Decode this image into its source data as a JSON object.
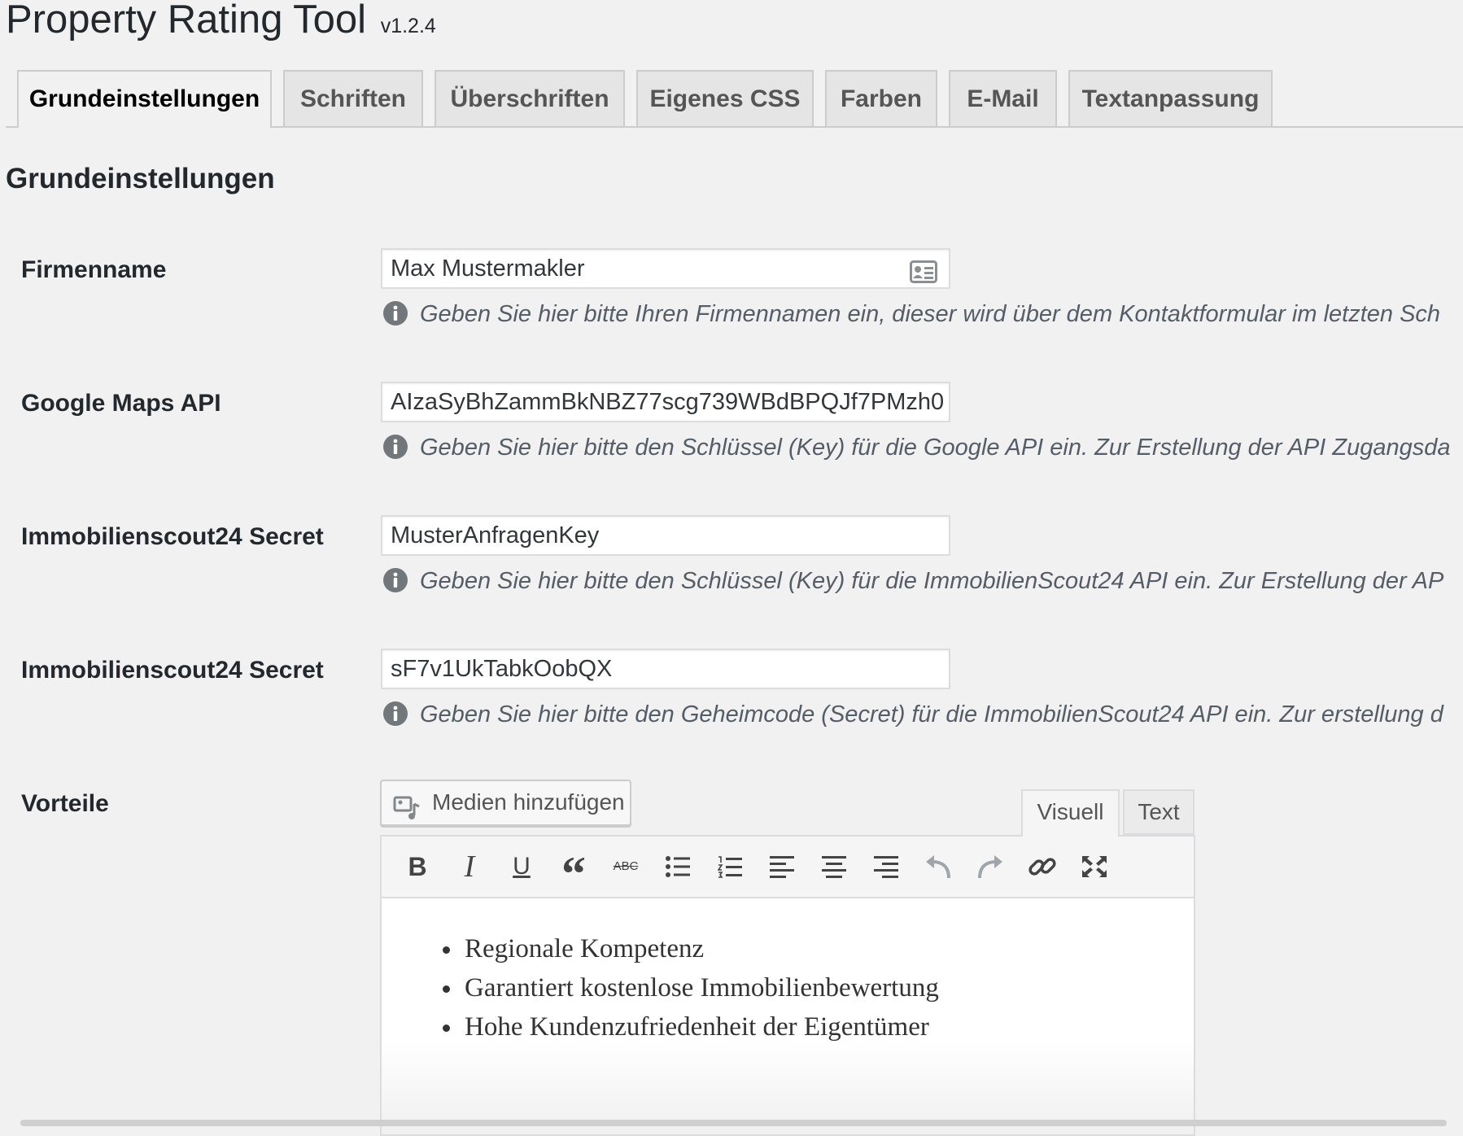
{
  "app": {
    "title": "Property Rating Tool",
    "version": "v1.2.4"
  },
  "tabs": [
    {
      "label": "Grundeinstellungen",
      "active": true
    },
    {
      "label": "Schriften"
    },
    {
      "label": "Überschriften"
    },
    {
      "label": "Eigenes CSS"
    },
    {
      "label": "Farben"
    },
    {
      "label": "E-Mail"
    },
    {
      "label": "Textanpassung"
    }
  ],
  "section": {
    "title": "Grundeinstellungen"
  },
  "fields": [
    {
      "label": "Firmenname",
      "value": "Max Mustermakler",
      "icon": "contact-card-icon",
      "hint": "Geben Sie hier bitte Ihren Firmennamen ein, dieser wird über dem Kontaktformular im letzten Sch"
    },
    {
      "label": "Google Maps API",
      "value": "AIzaSyBhZammBkNBZ77scg739WBdBPQJf7PMzh0",
      "hint": "Geben Sie hier bitte den Schlüssel (Key) für die Google API ein. Zur Erstellung der API Zugangsda"
    },
    {
      "label": "Immobilienscout24 Secret",
      "value": "MusterAnfragenKey",
      "hint": "Geben Sie hier bitte den Schlüssel (Key) für die ImmobilienScout24 API ein. Zur Erstellung der AP"
    },
    {
      "label": "Immobilienscout24 Secret",
      "value": "sF7v1UkTabkOobQX",
      "hint": "Geben Sie hier bitte den Geheimcode (Secret) für die ImmobilienScout24 API ein. Zur erstellung d"
    }
  ],
  "vorteile": {
    "label": "Vorteile",
    "media_button": "Medien hinzufügen",
    "editor_tabs": {
      "visual": "Visuell",
      "text": "Text"
    },
    "toolbar": {
      "bold": "B",
      "italic": "I",
      "underline": "U",
      "quote": "“",
      "strikethrough": "ABC"
    },
    "toolbar_icons": [
      "bold-icon",
      "italic-icon",
      "underline-icon",
      "blockquote-icon",
      "strikethrough-icon",
      "bullet-list-icon",
      "numbered-list-icon",
      "align-left-icon",
      "align-center-icon",
      "align-right-icon",
      "undo-icon",
      "redo-icon",
      "link-icon",
      "fullscreen-icon"
    ],
    "content": [
      "Regionale Kompetenz",
      "Garantiert kostenlose Immobilienbewertung",
      "Hohe Kundenzufriedenheit der Eigentümer"
    ]
  },
  "colors": {
    "background": "#f1f1f1",
    "text": "#23282d",
    "hint": "#555d66",
    "border": "#dddddd"
  }
}
